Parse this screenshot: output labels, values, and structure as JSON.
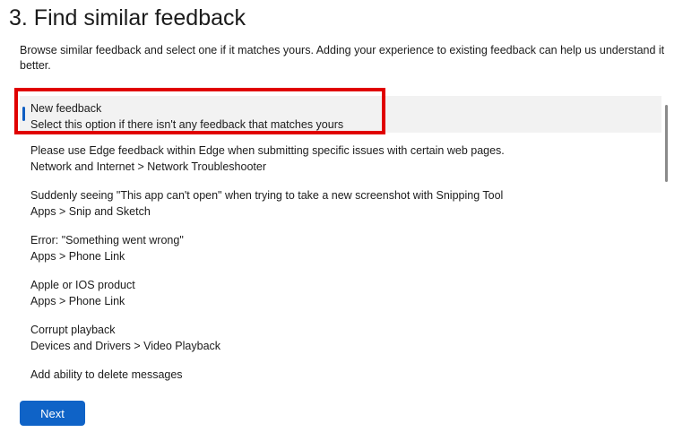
{
  "header": {
    "title": "3. Find similar feedback",
    "description": "Browse similar feedback and select one if it matches yours. Adding your experience to existing feedback can help us understand it better."
  },
  "feedback_list": {
    "items": [
      {
        "title": "New feedback",
        "subtitle": "Select this option if there isn't any feedback that matches yours",
        "selected": true
      },
      {
        "title": "Please use Edge feedback within Edge when submitting specific issues with certain web pages.",
        "subtitle": "Network and Internet > Network Troubleshooter",
        "selected": false
      },
      {
        "title": "Suddenly seeing \"This app can't open\" when trying to take a new screenshot with Snipping Tool",
        "subtitle": "Apps > Snip and Sketch",
        "selected": false
      },
      {
        "title": "Error: \"Something went wrong\"",
        "subtitle": "Apps > Phone Link",
        "selected": false
      },
      {
        "title": "Apple or IOS product",
        "subtitle": "Apps > Phone Link",
        "selected": false
      },
      {
        "title": "Corrupt playback",
        "subtitle": "Devices and Drivers > Video Playback",
        "selected": false
      },
      {
        "title": "Add ability to delete messages",
        "subtitle": "",
        "selected": false
      }
    ]
  },
  "actions": {
    "next_label": "Next"
  },
  "colors": {
    "accent": "#0f63c7",
    "highlight_box": "#e00000",
    "selected_bg": "#f2f2f2"
  }
}
